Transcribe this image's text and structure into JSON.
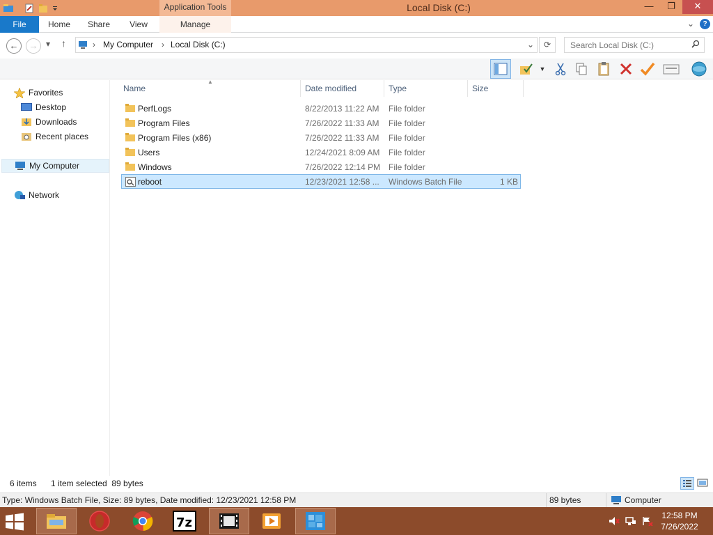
{
  "window": {
    "title": "Local Disk (C:)",
    "context_tab_group": "Application Tools",
    "controls": {
      "minimize": "—",
      "maximize": "❐",
      "close": "✕"
    }
  },
  "ribbon": {
    "tabs": [
      {
        "label": "File"
      },
      {
        "label": "Home"
      },
      {
        "label": "Share"
      },
      {
        "label": "View"
      },
      {
        "label": "Manage"
      }
    ],
    "expand_glyph": "⌄",
    "help_glyph": "?"
  },
  "address_bar": {
    "breadcrumbs": [
      "My Computer",
      "Local Disk (C:)"
    ],
    "search_placeholder": "Search Local Disk (C:)"
  },
  "nav_pane": {
    "favorites_label": "Favorites",
    "favorites": [
      {
        "label": "Desktop"
      },
      {
        "label": "Downloads"
      },
      {
        "label": "Recent places"
      }
    ],
    "computer_label": "My Computer",
    "network_label": "Network"
  },
  "file_list": {
    "columns": {
      "name": "Name",
      "date": "Date modified",
      "type": "Type",
      "size": "Size"
    },
    "rows": [
      {
        "name": "PerfLogs",
        "date": "8/22/2013 11:22 AM",
        "type": "File folder",
        "size": "",
        "icon": "folder-icon"
      },
      {
        "name": "Program Files",
        "date": "7/26/2022 11:33 AM",
        "type": "File folder",
        "size": "",
        "icon": "folder-icon"
      },
      {
        "name": "Program Files (x86)",
        "date": "7/26/2022 11:33 AM",
        "type": "File folder",
        "size": "",
        "icon": "folder-icon"
      },
      {
        "name": "Users",
        "date": "12/24/2021 8:09 AM",
        "type": "File folder",
        "size": "",
        "icon": "folder-icon"
      },
      {
        "name": "Windows",
        "date": "7/26/2022 12:14 PM",
        "type": "File folder",
        "size": "",
        "icon": "folder-icon"
      },
      {
        "name": "reboot",
        "date": "12/23/2021 12:58 ...",
        "type": "Windows Batch File",
        "size": "1 KB",
        "icon": "batch-file-icon",
        "selected": true
      }
    ]
  },
  "status_bar": {
    "item_count": "6 items",
    "selection": "1 item selected  89 bytes"
  },
  "details_bar": {
    "description": "Type: Windows Batch File, Size: 89 bytes, Date modified: 12/23/2021 12:58 PM",
    "size": "89 bytes",
    "location": "Computer"
  },
  "taskbar": {
    "apps": [
      "file-explorer-icon",
      "opera-icon",
      "chrome-icon",
      "7zip-icon",
      "video-editor-icon",
      "media-player-icon",
      "app-grid-icon"
    ],
    "time": "12:58 PM",
    "date": "7/26/2022"
  },
  "colors": {
    "title_bar": "#e89a6b",
    "file_tab": "#1979ca",
    "taskbar": "#8c4b2b",
    "selection": "#cce8ff"
  }
}
